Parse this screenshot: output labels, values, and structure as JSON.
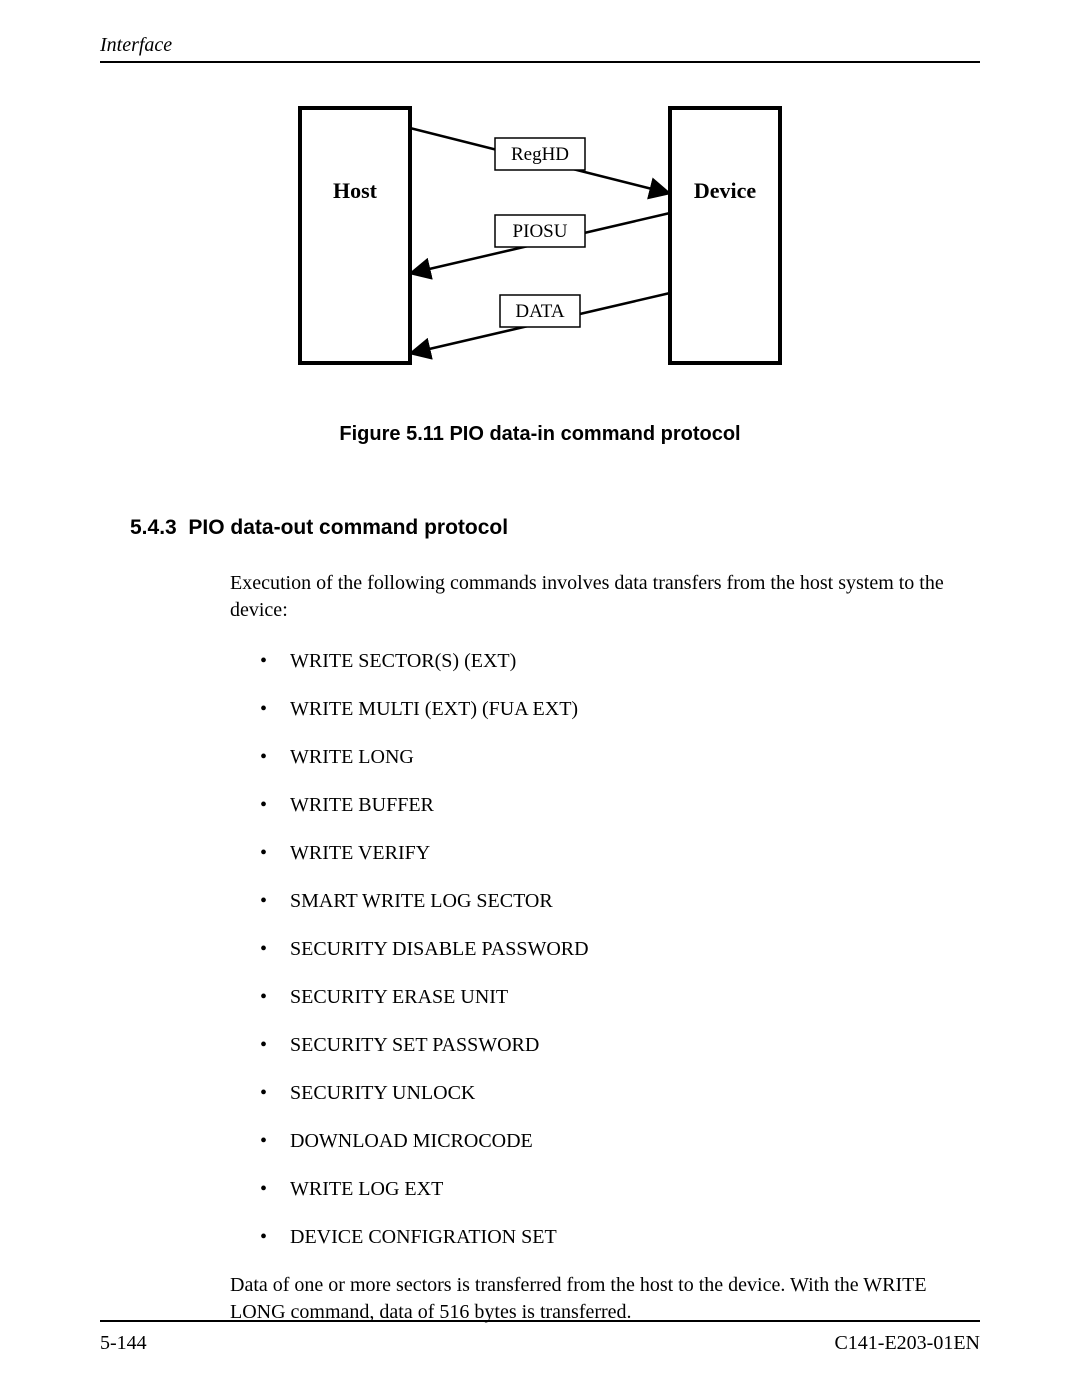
{
  "header": {
    "section": "Interface"
  },
  "figure": {
    "host_label": "Host",
    "device_label": "Device",
    "box_reghd": "RegHD",
    "box_piosu": "PIOSU",
    "box_data": "DATA",
    "caption": "Figure 5.11  PIO data-in command protocol"
  },
  "section": {
    "number": "5.4.3",
    "title": "PIO data-out command protocol"
  },
  "intro": "Execution of the following commands involves data transfers from the host system to the device:",
  "bullets": [
    "WRITE SECTOR(S) (EXT)",
    "WRITE MULTI (EXT) (FUA EXT)",
    "WRITE LONG",
    "WRITE BUFFER",
    "WRITE VERIFY",
    "SMART WRITE LOG SECTOR",
    "SECURITY DISABLE PASSWORD",
    "SECURITY ERASE UNIT",
    "SECURITY SET PASSWORD",
    "SECURITY UNLOCK",
    "DOWNLOAD MICROCODE",
    "WRITE LOG EXT",
    "DEVICE CONFIGRATION SET"
  ],
  "closing": "Data of one or more sectors is transferred from the host to the device.  With the WRITE LONG command, data of 516 bytes is transferred.",
  "footer": {
    "page": "5-144",
    "docid": "C141-E203-01EN"
  }
}
